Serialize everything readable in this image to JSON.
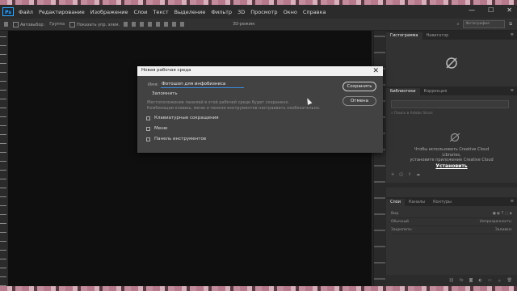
{
  "menubar": {
    "logo": "Ps",
    "items": [
      "Файл",
      "Редактирование",
      "Изображение",
      "Слои",
      "Текст",
      "Выделение",
      "Фильтр",
      "3D",
      "Просмотр",
      "Окно",
      "Справка"
    ],
    "controls": [
      "—",
      "☐",
      "✕"
    ]
  },
  "options_bar": {
    "autoselect": "Автовыбор:",
    "group": "Группа",
    "show_controls": "Показать упр. элем.",
    "mode_3d": "3D-режим:",
    "workspace": "Фотография"
  },
  "panels": {
    "top_tabs": [
      "Гистограмма",
      "Навигатор"
    ],
    "lib_tabs": [
      "Библиотеки",
      "Коррекция"
    ],
    "lib_search_placeholder": "Поиск в Adobe Stock",
    "lib_message": [
      "Чтобы использовать Creative Cloud",
      "Libraries,",
      "установите приложение Creative Cloud"
    ],
    "install_label": "Установить",
    "layers_tabs": [
      "Слои",
      "Каналы",
      "Контуры"
    ],
    "layers_kind": "Вид",
    "layers_blend": "Обычный",
    "layers_opacity": "Непрозрачность:",
    "layers_lock": "Закрепить:",
    "layers_fill": "Заливка:"
  },
  "dialog": {
    "title": "Новая рабочая среда",
    "close": "✕",
    "name_label": "Имя:",
    "name_value": "Фотошоп для инфобизнеса",
    "remember_label": "Запомнить",
    "description": [
      "Местоположение панелей в этой рабочей среде будет сохранено.",
      "Комбинации клавиш, меню и панели инструментов настраивать необязательно."
    ],
    "options": [
      {
        "label": "Клавиатурные сокращения",
        "checked": false
      },
      {
        "label": "Меню",
        "checked": false
      },
      {
        "label": "Панель инструментов",
        "checked": false
      }
    ],
    "save_label": "Сохранить",
    "cancel_label": "Отмена"
  }
}
